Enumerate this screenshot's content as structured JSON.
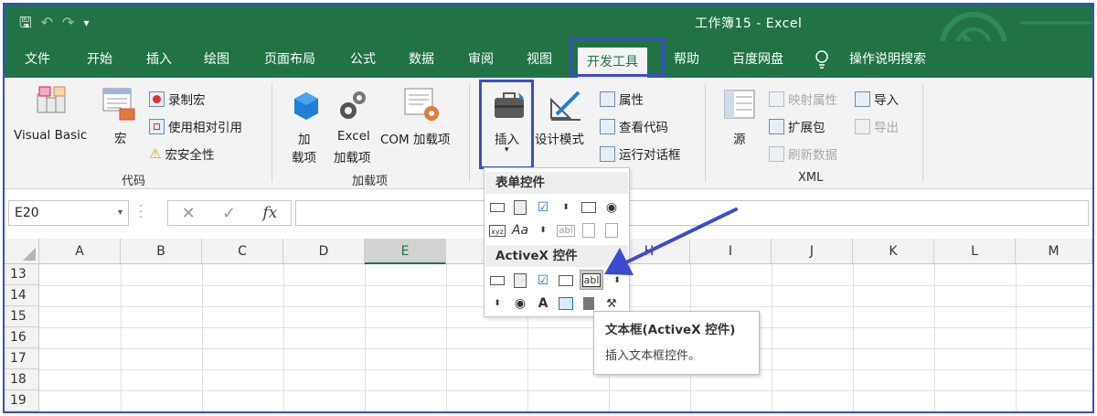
{
  "window": {
    "title": "工作簿15  -  Excel"
  },
  "qat": {
    "save_glyph": "🖫",
    "undo_glyph": "↶",
    "redo_glyph": "↷",
    "customize_glyph": "▾"
  },
  "tabs": [
    {
      "label": "文件"
    },
    {
      "label": "开始"
    },
    {
      "label": "插入"
    },
    {
      "label": "绘图"
    },
    {
      "label": "页面布局"
    },
    {
      "label": "公式"
    },
    {
      "label": "数据"
    },
    {
      "label": "审阅"
    },
    {
      "label": "视图"
    },
    {
      "label": "开发工具",
      "active": true
    },
    {
      "label": "帮助"
    },
    {
      "label": "百度网盘"
    },
    {
      "label": "操作说明搜索"
    }
  ],
  "ribbon": {
    "code": {
      "label": "代码",
      "visual_basic": "Visual Basic",
      "macros": "宏",
      "record_macro": "录制宏",
      "relative_refs": "使用相对引用",
      "macro_security": "宏安全性"
    },
    "addins": {
      "label": "加载项",
      "addins_line1": "加",
      "addins_line2": "载项",
      "excel_addins_line1": "Excel",
      "excel_addins_line2": "加载项",
      "com_addins": "COM 加载项"
    },
    "controls": {
      "insert": "插入",
      "design_mode": "设计模式",
      "properties": "属性",
      "view_code": "查看代码",
      "run_dialog": "运行对话框"
    },
    "xml": {
      "label": "XML",
      "source": "源",
      "map_properties": "映射属性",
      "expansion_packs": "扩展包",
      "refresh_data": "刷新数据",
      "import": "导入",
      "export": "导出"
    }
  },
  "formula_bar": {
    "name_box": "E20",
    "cancel": "✕",
    "enter": "✓",
    "fx": "fx",
    "value": ""
  },
  "grid": {
    "columns": [
      "A",
      "B",
      "C",
      "D",
      "E",
      "F",
      "G",
      "H",
      "I",
      "J",
      "K",
      "L",
      "M"
    ],
    "selected_column": "E",
    "rows": [
      "13",
      "14",
      "15",
      "16",
      "17",
      "18",
      "19"
    ]
  },
  "insert_menu": {
    "form_controls_header": "表单控件",
    "activex_header": "ActiveX 控件"
  },
  "tooltip": {
    "title": "文本框(ActiveX 控件)",
    "body": "插入文本框控件。"
  },
  "colors": {
    "excel_green": "#217346",
    "highlight_blue": "#3b4ccf"
  }
}
